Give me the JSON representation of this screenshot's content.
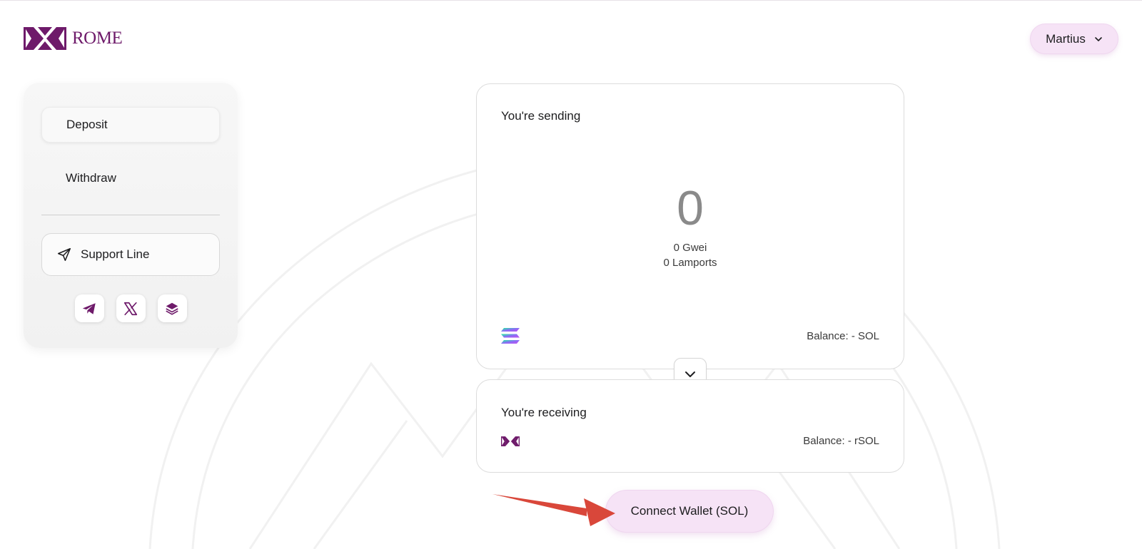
{
  "header": {
    "logo_text": "ROME",
    "user": {
      "name": "Martius"
    }
  },
  "sidebar": {
    "items": [
      {
        "label": "Deposit",
        "active": true
      },
      {
        "label": "Withdraw",
        "active": false
      }
    ],
    "support_label": "Support Line",
    "socials": [
      {
        "icon": "telegram-icon"
      },
      {
        "icon": "x-icon"
      },
      {
        "icon": "layers-icon"
      }
    ]
  },
  "send_card": {
    "label": "You're sending",
    "amount": "0",
    "gwei": "0 Gwei",
    "lamports": "0 Lamports",
    "token_icon": "solana-icon",
    "balance": "Balance: - SOL"
  },
  "receive_card": {
    "label": "You're receiving",
    "token_icon": "rome-icon",
    "balance": "Balance: - rSOL"
  },
  "connect_button": {
    "label": "Connect Wallet (SOL)"
  },
  "colors": {
    "brand": "#6e1a6a",
    "pill_bg": "#f6e3f6",
    "arrow": "#d9473a"
  }
}
